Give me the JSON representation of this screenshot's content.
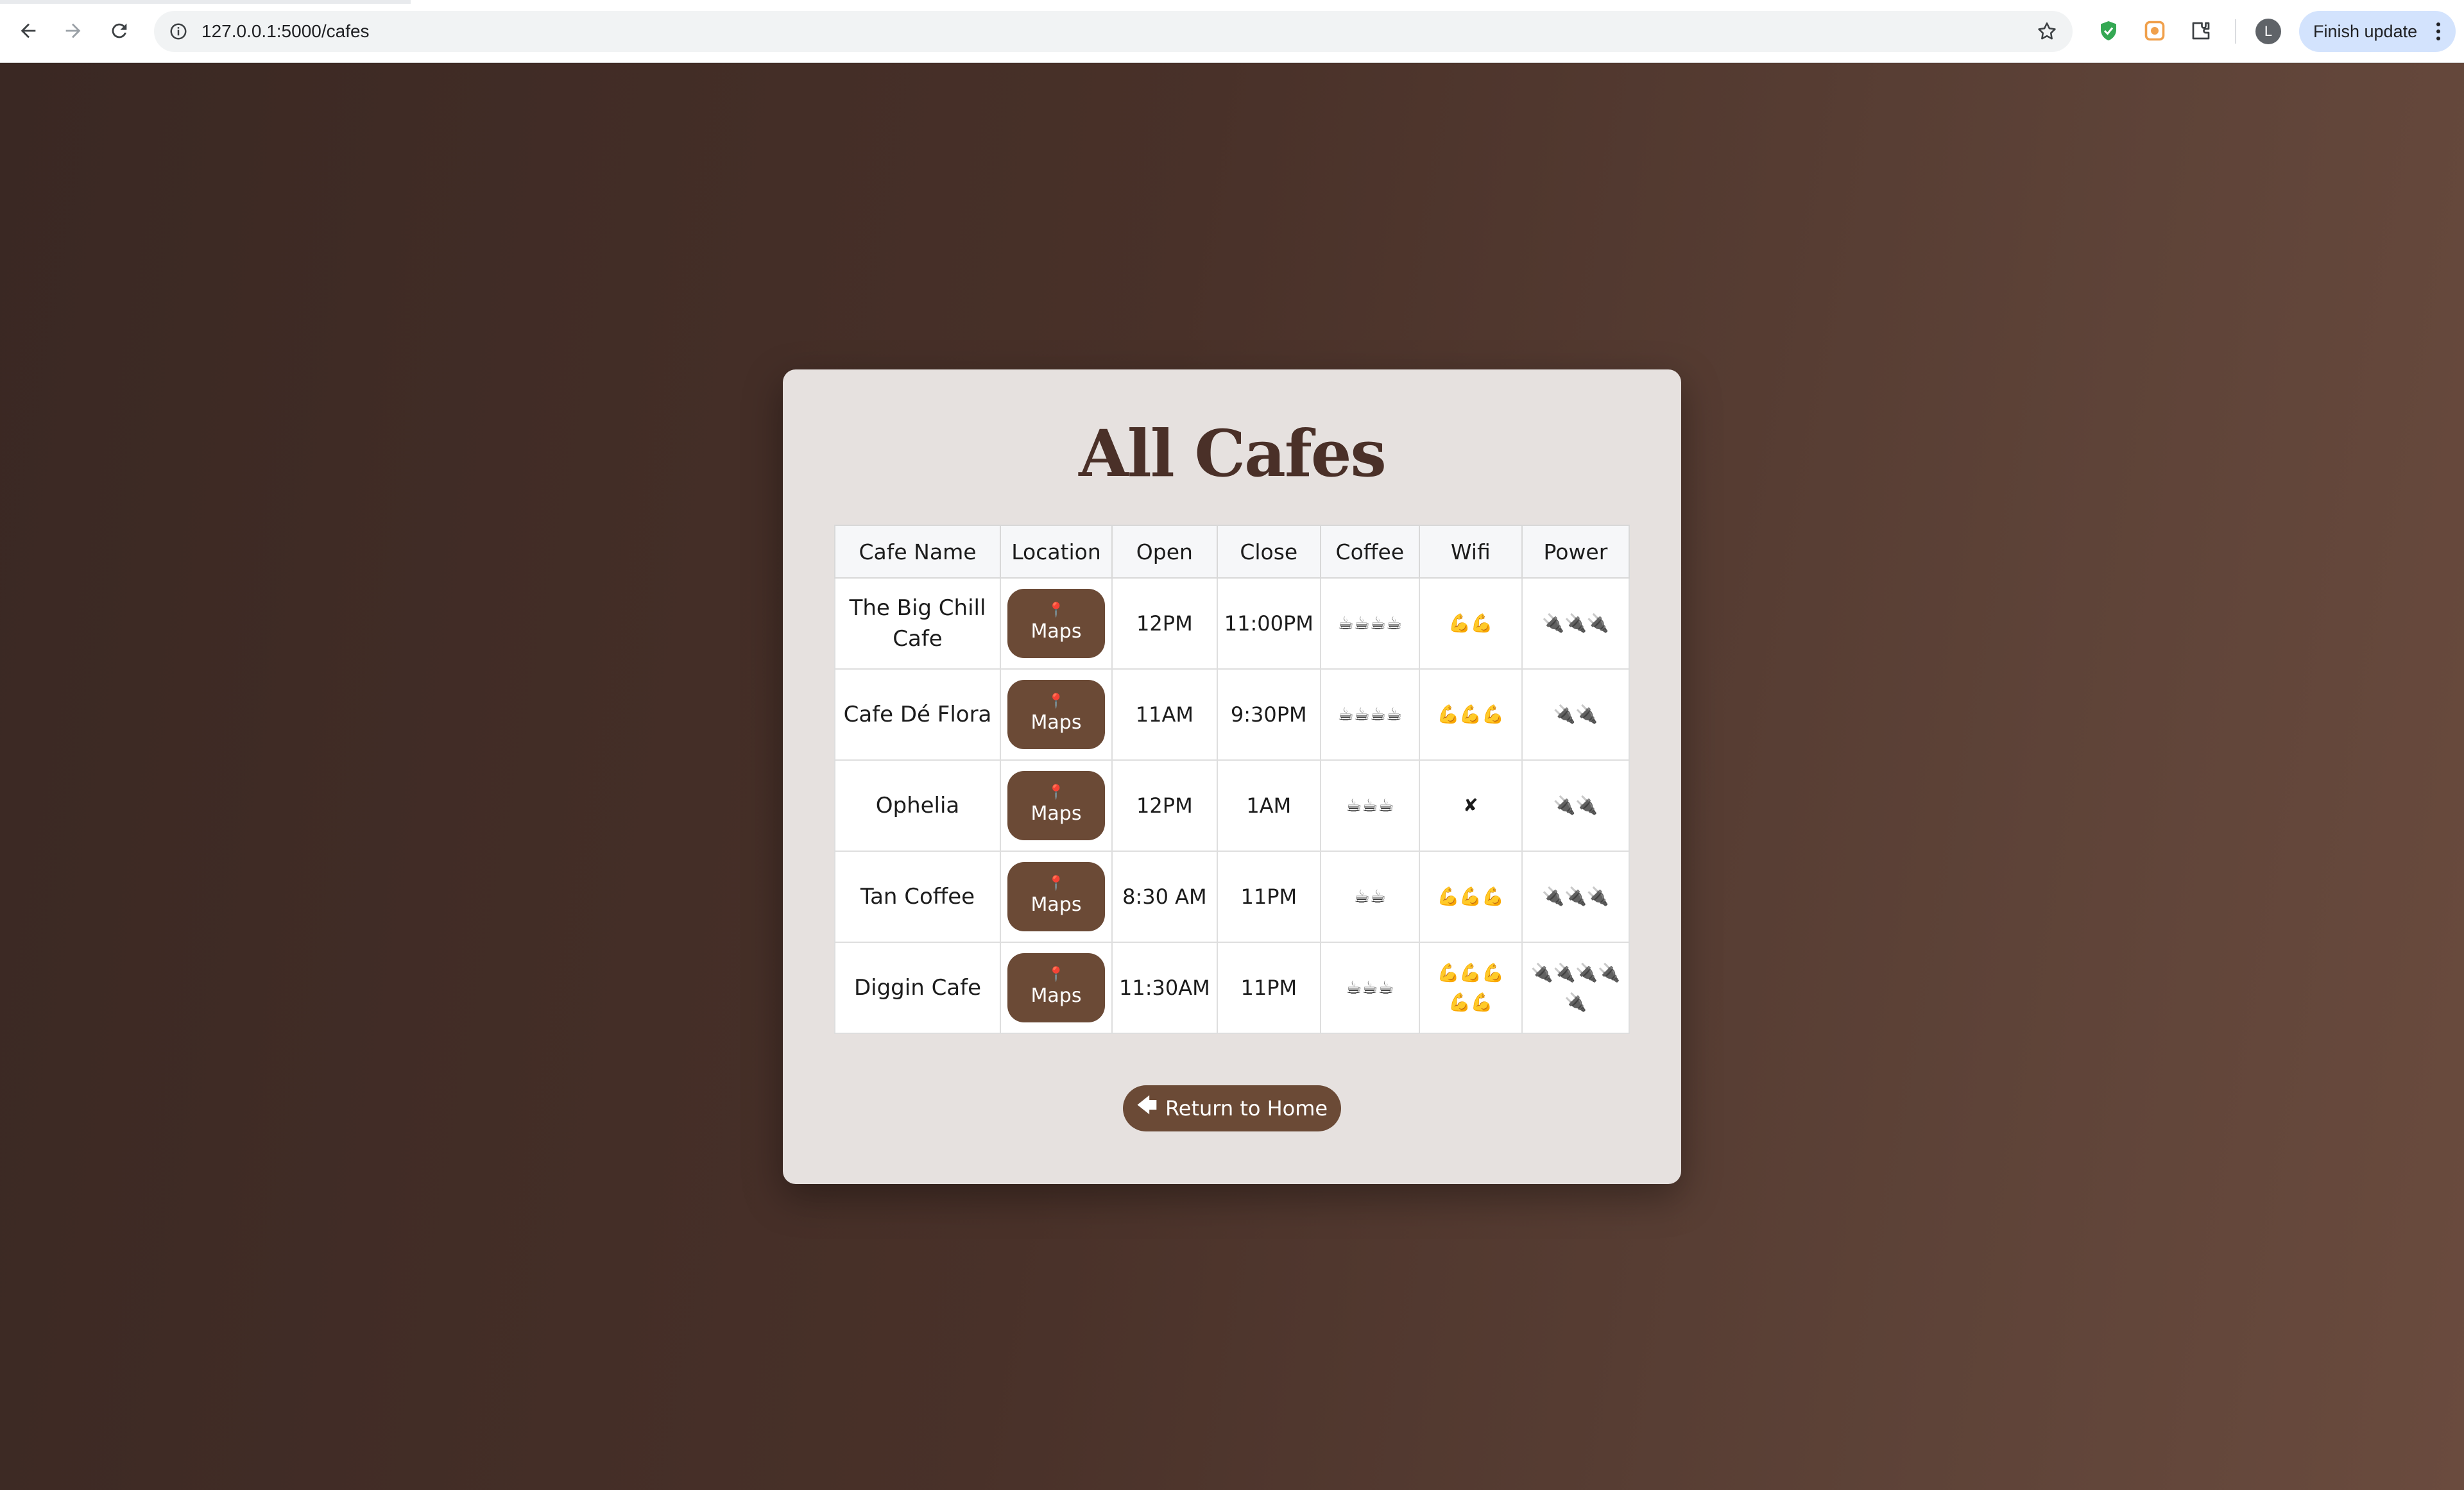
{
  "browser": {
    "url": "127.0.0.1:5000/cafes",
    "update_label": "Finish update",
    "avatar_initial": "L"
  },
  "page": {
    "title": "All Cafes",
    "columns": [
      "Cafe Name",
      "Location",
      "Open",
      "Close",
      "Coffee",
      "Wifi",
      "Power"
    ],
    "rows": [
      {
        "name": "The Big Chill Cafe",
        "pin": "📍",
        "maps": "Maps",
        "open": "12PM",
        "close": "11:00PM",
        "coffee": "☕☕☕☕",
        "wifi": "💪💪",
        "power": "🔌🔌🔌"
      },
      {
        "name": "Cafe Dé Flora",
        "pin": "📍",
        "maps": "Maps",
        "open": "11AM",
        "close": "9:30PM",
        "coffee": "☕☕☕☕",
        "wifi": "💪💪💪",
        "power": "🔌🔌"
      },
      {
        "name": "Ophelia",
        "pin": "📍",
        "maps": "Maps",
        "open": "12PM",
        "close": "1AM",
        "coffee": "☕☕☕",
        "wifi": "✘",
        "power": "🔌🔌"
      },
      {
        "name": "Tan Coffee",
        "pin": "📍",
        "maps": "Maps",
        "open": "8:30 AM",
        "close": "11PM",
        "coffee": "☕☕",
        "wifi": "💪💪💪",
        "power": "🔌🔌🔌"
      },
      {
        "name": "Diggin Cafe",
        "pin": "📍",
        "maps": "Maps",
        "open": "11:30AM",
        "close": "11PM",
        "coffee": "☕☕☕",
        "wifi": "💪💪💪💪💪",
        "power": "🔌🔌🔌🔌🔌"
      }
    ],
    "return_arrow": "🡄",
    "return_label": "Return to Home"
  },
  "colors": {
    "accent": "#6b4a36",
    "title": "#4a3028",
    "card": "#e6e1df"
  }
}
